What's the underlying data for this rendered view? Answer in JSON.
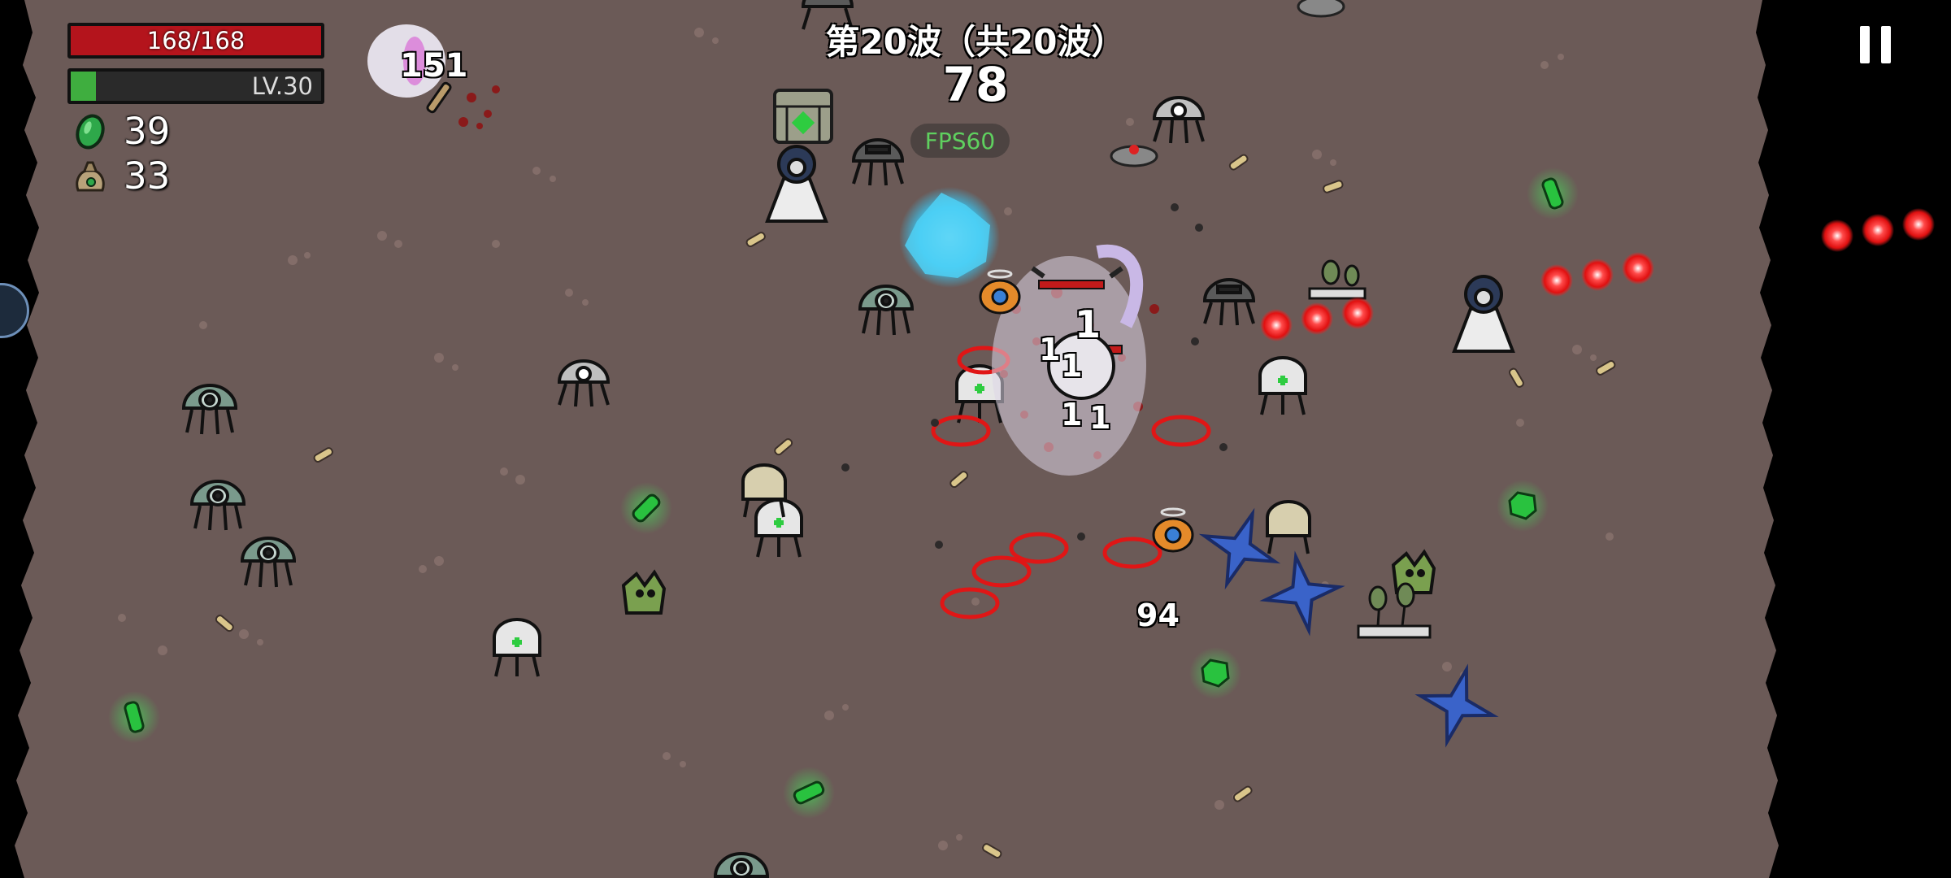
{
  "player": {
    "hp_text": "168/168",
    "hp_fraction": 1.0,
    "level_text": "LV.30",
    "xp_fraction": 0.1
  },
  "resources": {
    "materials": "39",
    "bag": "33"
  },
  "wave": {
    "title": "第20波（共20波）",
    "timer": "78",
    "fps": "FPS60"
  },
  "damage_numbers": [
    "151",
    "1",
    "1",
    "1",
    "1",
    "1",
    "94"
  ],
  "icons": {
    "material": "material-icon",
    "bag": "bag-icon",
    "pause": "pause-icon"
  },
  "colors": {
    "ground": "#6b5a57",
    "hp": "#b4141c",
    "xp": "#3fae3f",
    "fps": "#5fd05f",
    "material_glow": "#2ecc40",
    "enemy_bullet": "#ff2a2a"
  }
}
